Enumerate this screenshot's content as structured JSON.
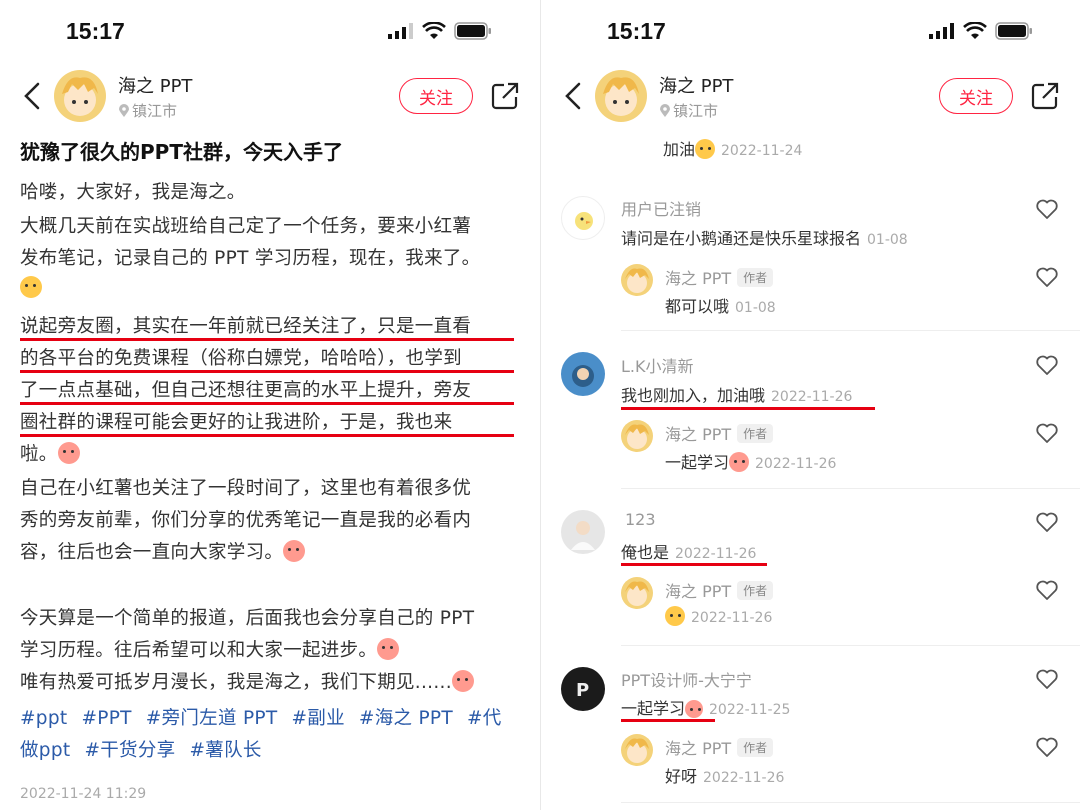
{
  "status": {
    "time_left": "15:17",
    "time_right": "15:17"
  },
  "author": {
    "name": "海之 PPT",
    "location": "镇江市",
    "follow_label": "关注"
  },
  "post": {
    "title": "犹豫了很久的PPT社群，今天入手了",
    "lines": [
      "哈喽，大家好，我是海之。",
      "大概几天前在实战班给自己定了一个任务，要来小红薯",
      "发布笔记，记录自己的 PPT 学习历程，现在，我来了。",
      "说起旁友圈，其实在一年前就已经关注了，只是一直看",
      "的各平台的免费课程（俗称白嫖党，哈哈哈），也学到",
      "了一点点基础，但自己还想往更高的水平上提升，旁友",
      "圈社群的课程可能会更好的让我进阶，于是，我也来",
      "啦。",
      "自己在小红薯也关注了一段时间了，这里也有着很多优",
      "秀的旁友前辈，你们分享的优秀笔记一直是我的必看内",
      "容，往后也会一直向大家学习。",
      "今天算是一个简单的报道，后面我也会分享自己的 PPT",
      "学习历程。往后希望可以和大家一起进步。",
      "唯有热爱可抵岁月漫长，我是海之，我们下期见......"
    ],
    "tags_line1": [
      "#ppt",
      "#PPT",
      "#旁门左道 PPT",
      "#副业",
      "#海之 PPT",
      "#代"
    ],
    "tags_line2": [
      "做ppt",
      "#干货分享",
      "#薯队长"
    ],
    "date": "2022-11-24 11:29"
  },
  "comments": {
    "top_partial": {
      "text": "加油",
      "date": "2022-11-24"
    },
    "threads": [
      {
        "user": "用户已注销",
        "text": "请问是在小鹅通还是快乐星球报名",
        "date": "01-08",
        "reply": {
          "user": "海之 PPT",
          "badge": "作者",
          "text": "都可以哦",
          "date": "01-08"
        }
      },
      {
        "user": "L.K小清新",
        "text": "我也刚加入，加油哦",
        "date": "2022-11-26",
        "reply": {
          "user": "海之 PPT",
          "badge": "作者",
          "text": "一起学习",
          "date": "2022-11-26"
        }
      },
      {
        "user": "123",
        "text": "俺也是",
        "date": "2022-11-26",
        "reply": {
          "user": "海之 PPT",
          "badge": "作者",
          "text": "",
          "date": "2022-11-26"
        }
      },
      {
        "user": "PPT设计师-大宁宁",
        "text": "一起学习",
        "date": "2022-11-25",
        "reply": {
          "user": "海之 PPT",
          "badge": "作者",
          "text": "好呀",
          "date": "2022-11-26"
        }
      }
    ]
  },
  "colors": {
    "accent": "#ff2442",
    "underline": "#e60012",
    "tag": "#2b5aa8"
  }
}
